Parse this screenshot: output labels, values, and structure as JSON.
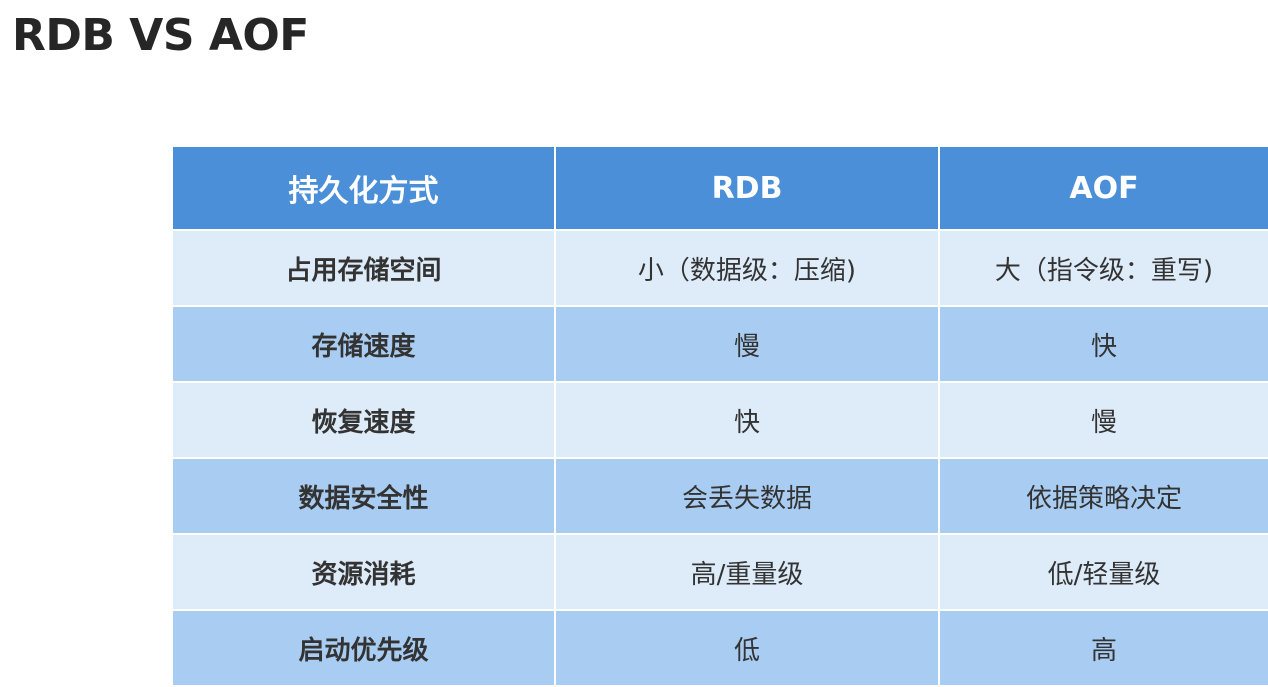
{
  "title": "RDB VS AOF",
  "table": {
    "headers": [
      "持久化方式",
      "RDB",
      "AOF"
    ],
    "rows": [
      [
        "占用存储空间",
        "小（数据级：压缩)",
        "大（指令级：重写)"
      ],
      [
        "存储速度",
        "慢",
        "快"
      ],
      [
        "恢复速度",
        "快",
        "慢"
      ],
      [
        "数据安全性",
        "会丢失数据",
        "依据策略决定"
      ],
      [
        "资源消耗",
        "高/重量级",
        "低/轻量级"
      ],
      [
        "启动优先级",
        "低",
        "高"
      ]
    ]
  },
  "colors": {
    "header_bg": "#4a8fd8",
    "row_light": "#deebf8",
    "row_dark": "#a9cdf2",
    "title_text": "#262626"
  }
}
